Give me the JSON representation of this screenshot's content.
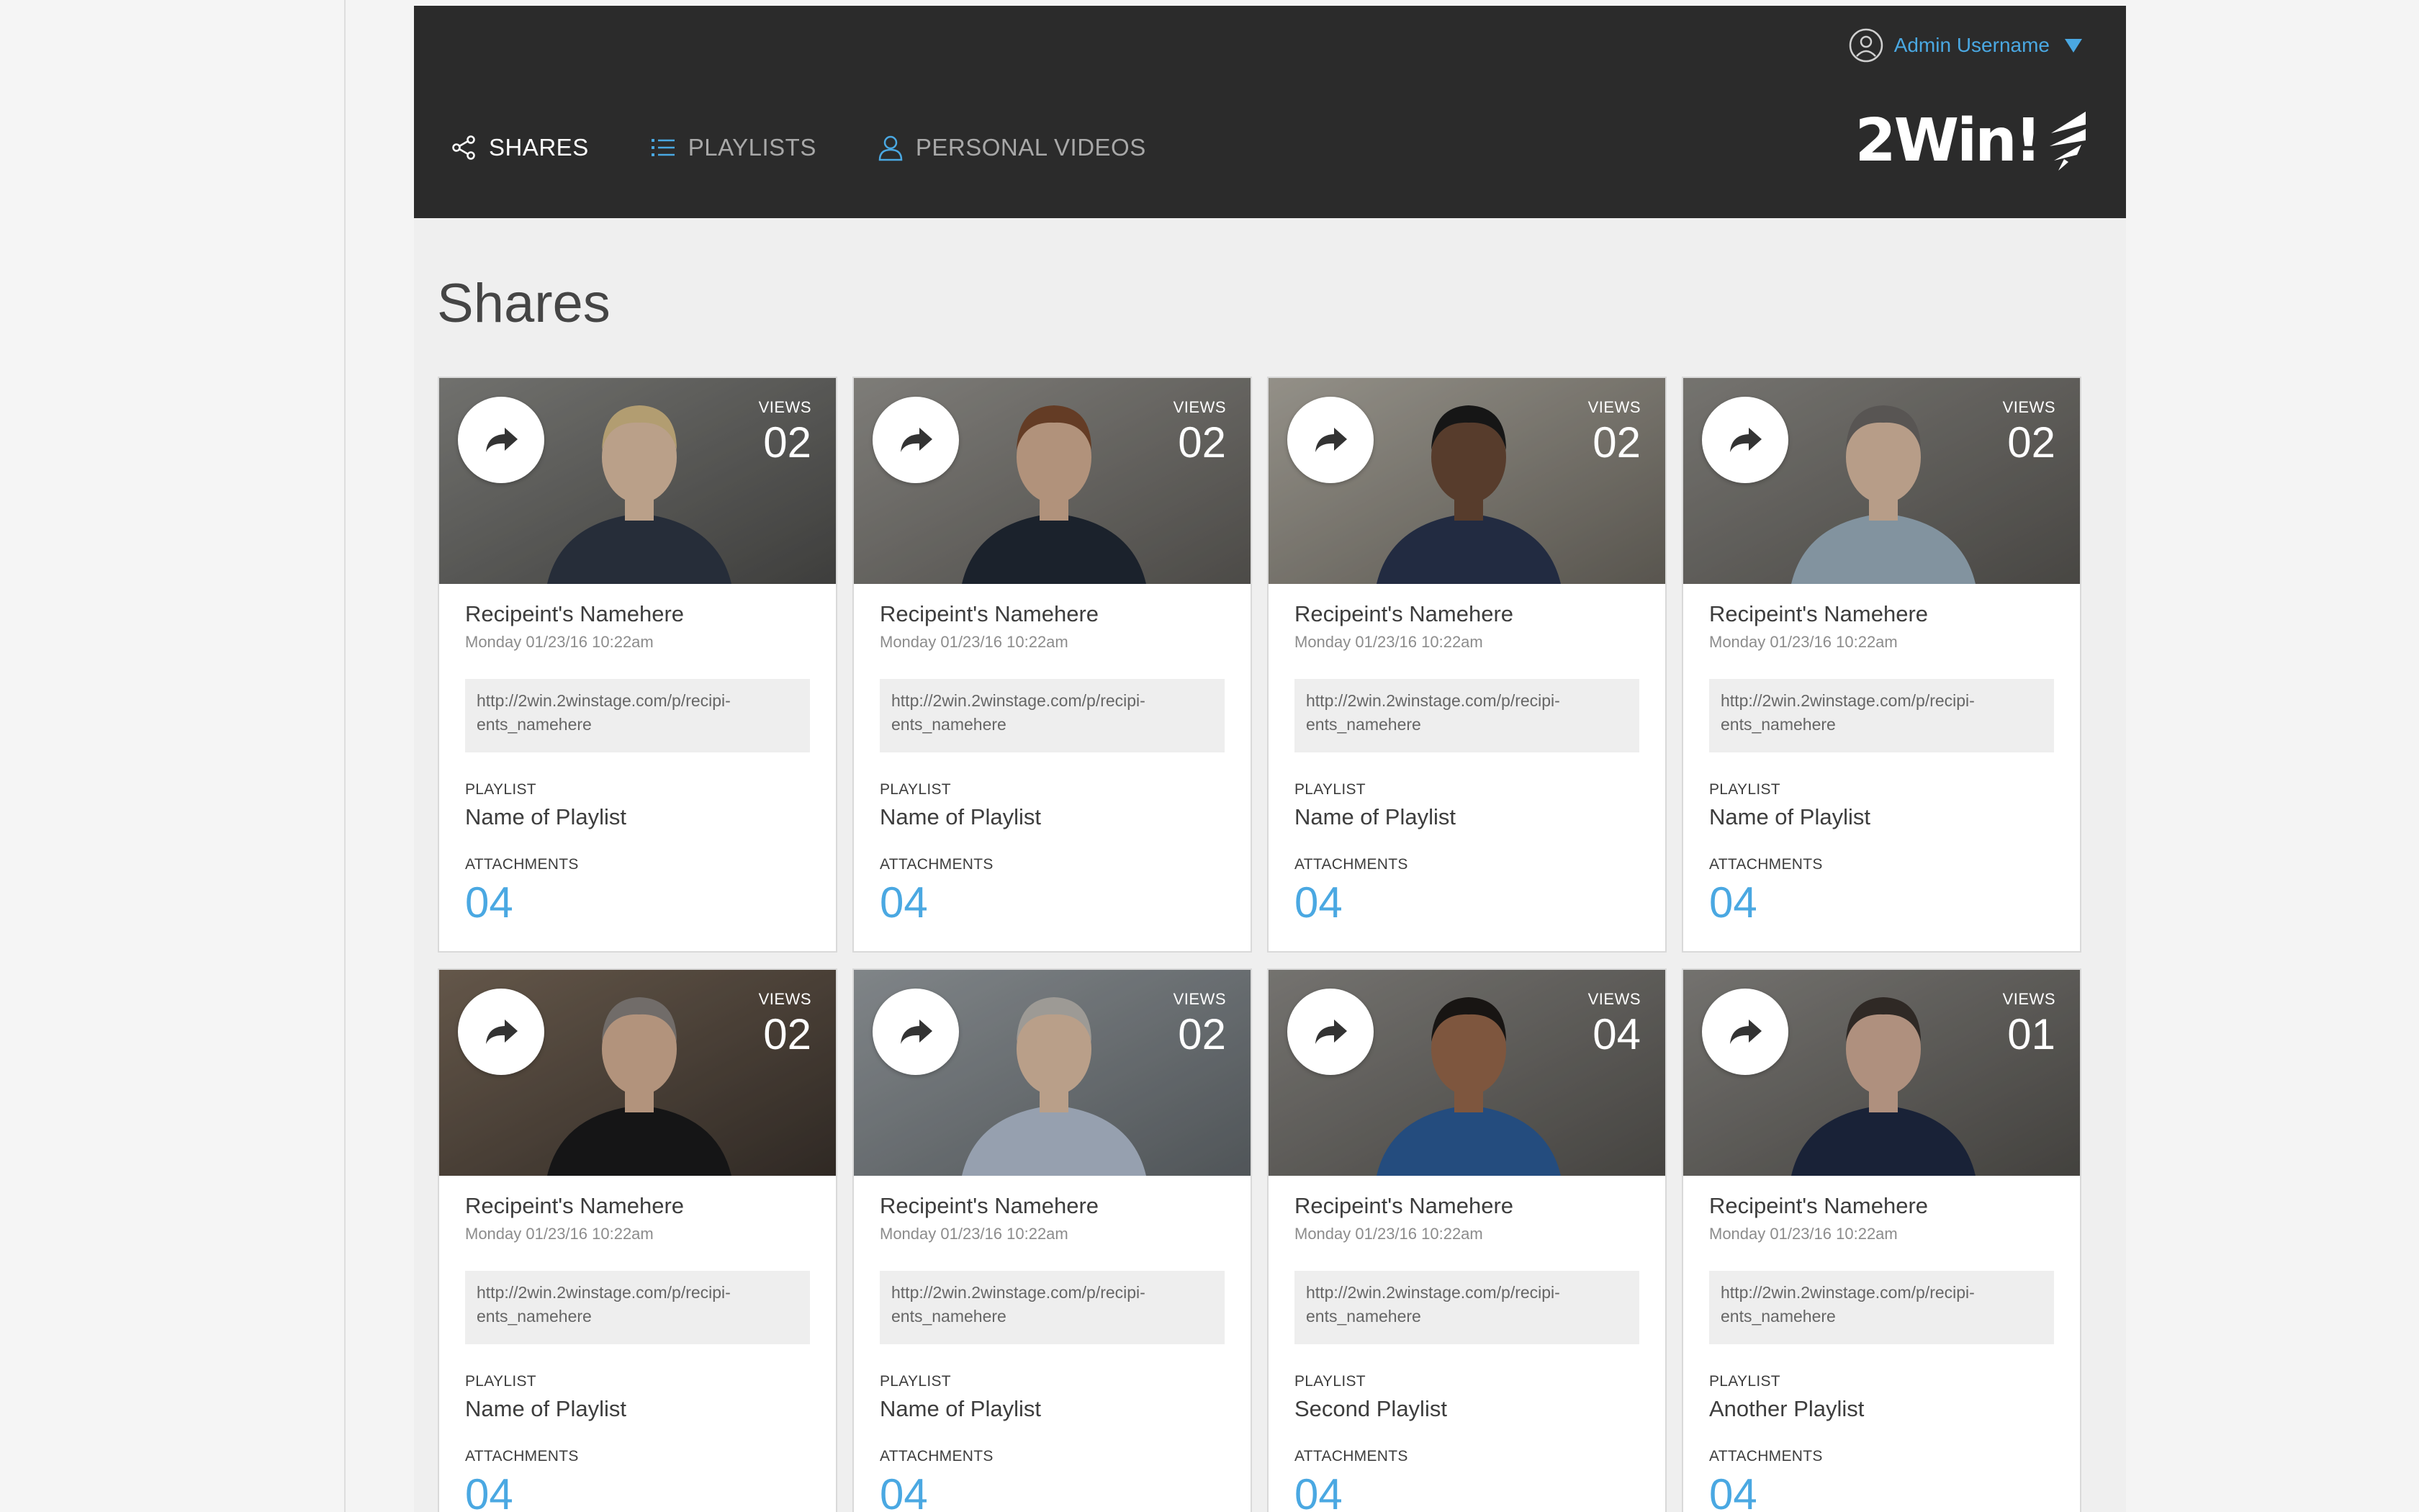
{
  "header": {
    "user": "Admin Username",
    "logo": "2Win!",
    "nav": [
      {
        "label": "SHARES",
        "icon": "share-icon"
      },
      {
        "label": "PLAYLISTS",
        "icon": "list-icon"
      },
      {
        "label": "PERSONAL VIDEOS",
        "icon": "person-icon"
      }
    ],
    "active_nav": "SHARES"
  },
  "page": {
    "title": "Shares"
  },
  "colors": {
    "header_bg": "#2b2b2b",
    "accent": "#4aa8e2",
    "page_bg": "#efefef"
  },
  "cards": [
    {
      "views_label": "VIEWS",
      "views": "02",
      "name": "Recipeint's Namehere",
      "date": "Monday 01/23/16 10:22am",
      "link": "http://2win.2winstage.com/p/recipi-ents_namehere",
      "playlist_label": "PLAYLIST",
      "playlist": "Name of Playlist",
      "attachments_label": "ATTACHMENTS",
      "attachments": "04"
    },
    {
      "views_label": "VIEWS",
      "views": "02",
      "name": "Recipeint's Namehere",
      "date": "Monday 01/23/16 10:22am",
      "link": "http://2win.2winstage.com/p/recipi-ents_namehere",
      "playlist_label": "PLAYLIST",
      "playlist": "Name of Playlist",
      "attachments_label": "ATTACHMENTS",
      "attachments": "04"
    },
    {
      "views_label": "VIEWS",
      "views": "02",
      "name": "Recipeint's Namehere",
      "date": "Monday 01/23/16 10:22am",
      "link": "http://2win.2winstage.com/p/recipi-ents_namehere",
      "playlist_label": "PLAYLIST",
      "playlist": "Name of Playlist",
      "attachments_label": "ATTACHMENTS",
      "attachments": "04"
    },
    {
      "views_label": "VIEWS",
      "views": "02",
      "name": "Recipeint's Namehere",
      "date": "Monday 01/23/16 10:22am",
      "link": "http://2win.2winstage.com/p/recipi-ents_namehere",
      "playlist_label": "PLAYLIST",
      "playlist": "Name of Playlist",
      "attachments_label": "ATTACHMENTS",
      "attachments": "04"
    },
    {
      "views_label": "VIEWS",
      "views": "02",
      "name": "Recipeint's Namehere",
      "date": "Monday 01/23/16 10:22am",
      "link": "http://2win.2winstage.com/p/recipi-ents_namehere",
      "playlist_label": "PLAYLIST",
      "playlist": "Name of Playlist",
      "attachments_label": "ATTACHMENTS",
      "attachments": "04"
    },
    {
      "views_label": "VIEWS",
      "views": "02",
      "name": "Recipeint's Namehere",
      "date": "Monday 01/23/16 10:22am",
      "link": "http://2win.2winstage.com/p/recipi-ents_namehere",
      "playlist_label": "PLAYLIST",
      "playlist": "Name of Playlist",
      "attachments_label": "ATTACHMENTS",
      "attachments": "04"
    },
    {
      "views_label": "VIEWS",
      "views": "04",
      "name": "Recipeint's Namehere",
      "date": "Monday 01/23/16 10:22am",
      "link": "http://2win.2winstage.com/p/recipi-ents_namehere",
      "playlist_label": "PLAYLIST",
      "playlist": "Second Playlist",
      "attachments_label": "ATTACHMENTS",
      "attachments": "04"
    },
    {
      "views_label": "VIEWS",
      "views": "01",
      "name": "Recipeint's Namehere",
      "date": "Monday 01/23/16 10:22am",
      "link": "http://2win.2winstage.com/p/recipi-ents_namehere",
      "playlist_label": "PLAYLIST",
      "playlist": "Another Playlist",
      "attachments_label": "ATTACHMENTS",
      "attachments": "04"
    }
  ]
}
